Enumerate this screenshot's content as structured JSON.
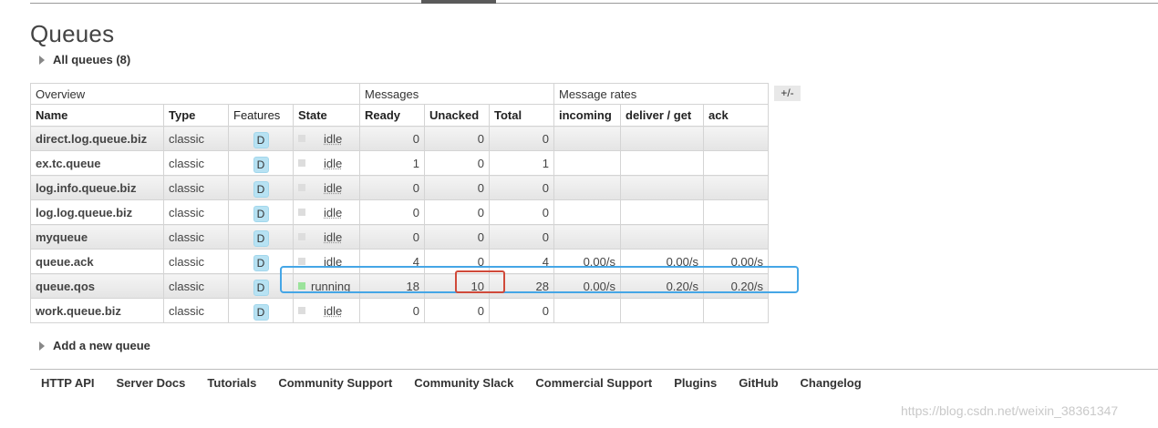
{
  "page": {
    "title": "Queues"
  },
  "all_queues_label": "All queues (8)",
  "add_queue_label": "Add a new queue",
  "column_toggle": "+/-",
  "table": {
    "groups": [
      "Overview",
      "Messages",
      "Message rates"
    ],
    "columns": [
      "Name",
      "Type",
      "Features",
      "State",
      "Ready",
      "Unacked",
      "Total",
      "incoming",
      "deliver / get",
      "ack"
    ],
    "rows": [
      {
        "name": "direct.log.queue.biz",
        "type": "classic",
        "feature": "D",
        "state": "idle",
        "ready": "0",
        "unacked": "0",
        "total": "0",
        "incoming": "",
        "deliver": "",
        "ack": ""
      },
      {
        "name": "ex.tc.queue",
        "type": "classic",
        "feature": "D",
        "state": "idle",
        "ready": "1",
        "unacked": "0",
        "total": "1",
        "incoming": "",
        "deliver": "",
        "ack": ""
      },
      {
        "name": "log.info.queue.biz",
        "type": "classic",
        "feature": "D",
        "state": "idle",
        "ready": "0",
        "unacked": "0",
        "total": "0",
        "incoming": "",
        "deliver": "",
        "ack": ""
      },
      {
        "name": "log.log.queue.biz",
        "type": "classic",
        "feature": "D",
        "state": "idle",
        "ready": "0",
        "unacked": "0",
        "total": "0",
        "incoming": "",
        "deliver": "",
        "ack": ""
      },
      {
        "name": "myqueue",
        "type": "classic",
        "feature": "D",
        "state": "idle",
        "ready": "0",
        "unacked": "0",
        "total": "0",
        "incoming": "",
        "deliver": "",
        "ack": ""
      },
      {
        "name": "queue.ack",
        "type": "classic",
        "feature": "D",
        "state": "idle",
        "ready": "4",
        "unacked": "0",
        "total": "4",
        "incoming": "0.00/s",
        "deliver": "0.00/s",
        "ack": "0.00/s"
      },
      {
        "name": "queue.qos",
        "type": "classic",
        "feature": "D",
        "state": "running",
        "ready": "18",
        "unacked": "10",
        "total": "28",
        "incoming": "0.00/s",
        "deliver": "0.20/s",
        "ack": "0.20/s"
      },
      {
        "name": "work.queue.biz",
        "type": "classic",
        "feature": "D",
        "state": "idle",
        "ready": "0",
        "unacked": "0",
        "total": "0",
        "incoming": "",
        "deliver": "",
        "ack": ""
      }
    ]
  },
  "footer": {
    "links": [
      "HTTP API",
      "Server Docs",
      "Tutorials",
      "Community Support",
      "Community Slack",
      "Commercial Support",
      "Plugins",
      "GitHub",
      "Changelog"
    ]
  },
  "watermark": "https://blog.csdn.net/weixin_38361347",
  "colors": {
    "idle": "#dddddd",
    "running": "#9be39b",
    "highlight_row": "#45a6e6",
    "highlight_cell": "#d04a3a",
    "feature_badge": "#b7e2f3"
  }
}
